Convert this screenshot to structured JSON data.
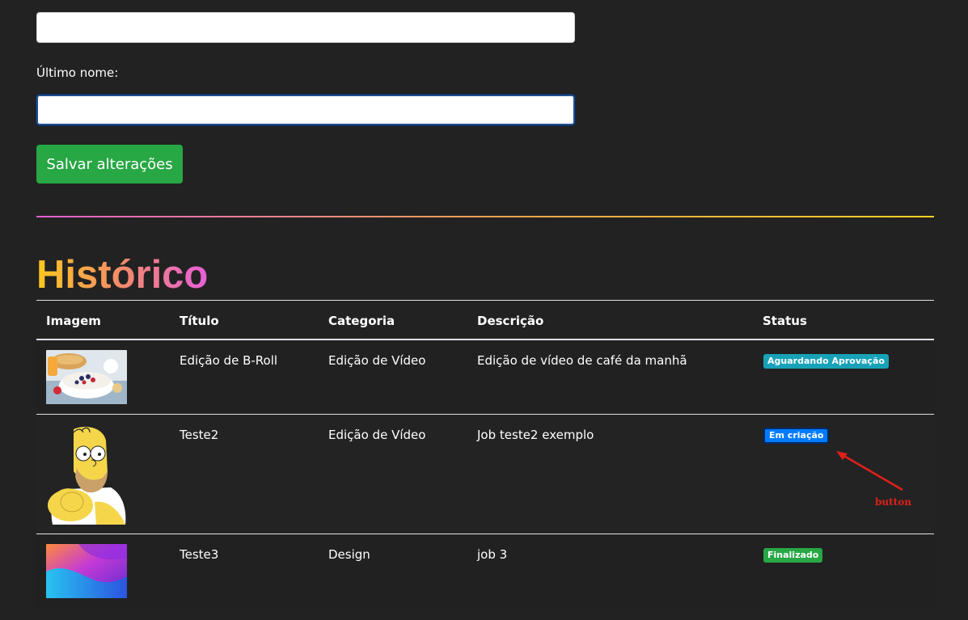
{
  "form": {
    "first_name_value": "",
    "last_name_label": "Último nome:",
    "last_name_value": "",
    "save_label": "Salvar alterações"
  },
  "history": {
    "title": "Histórico",
    "columns": [
      "Imagem",
      "Título",
      "Categoria",
      "Descrição",
      "Status"
    ],
    "rows": [
      {
        "image": "breakfast-photo",
        "title": "Edição de B-Roll",
        "category": "Edição de Vídeo",
        "description": "Edição de vídeo de café da manhã",
        "status": "Aguardando Aprovação",
        "status_color": "#17a2b8"
      },
      {
        "image": "homer-simpson-cartoon",
        "title": "Teste2",
        "category": "Edição de Vídeo",
        "description": "Job teste2 exemplo",
        "status": "Em criação",
        "status_color": "#007bff"
      },
      {
        "image": "abstract-gradient-wallpaper",
        "title": "Teste3",
        "category": "Design",
        "description": "job 3",
        "status": "Finalizado",
        "status_color": "#28a745"
      }
    ]
  },
  "annotation": {
    "label": "button",
    "color": "#e0201a"
  },
  "colors": {
    "background": "#222222",
    "divider_gradient": [
      "#e060d0",
      "#f5a050",
      "#ffd21f"
    ],
    "title_gradient": [
      "#ffc81e",
      "#f28a6a",
      "#e85fd9"
    ]
  }
}
